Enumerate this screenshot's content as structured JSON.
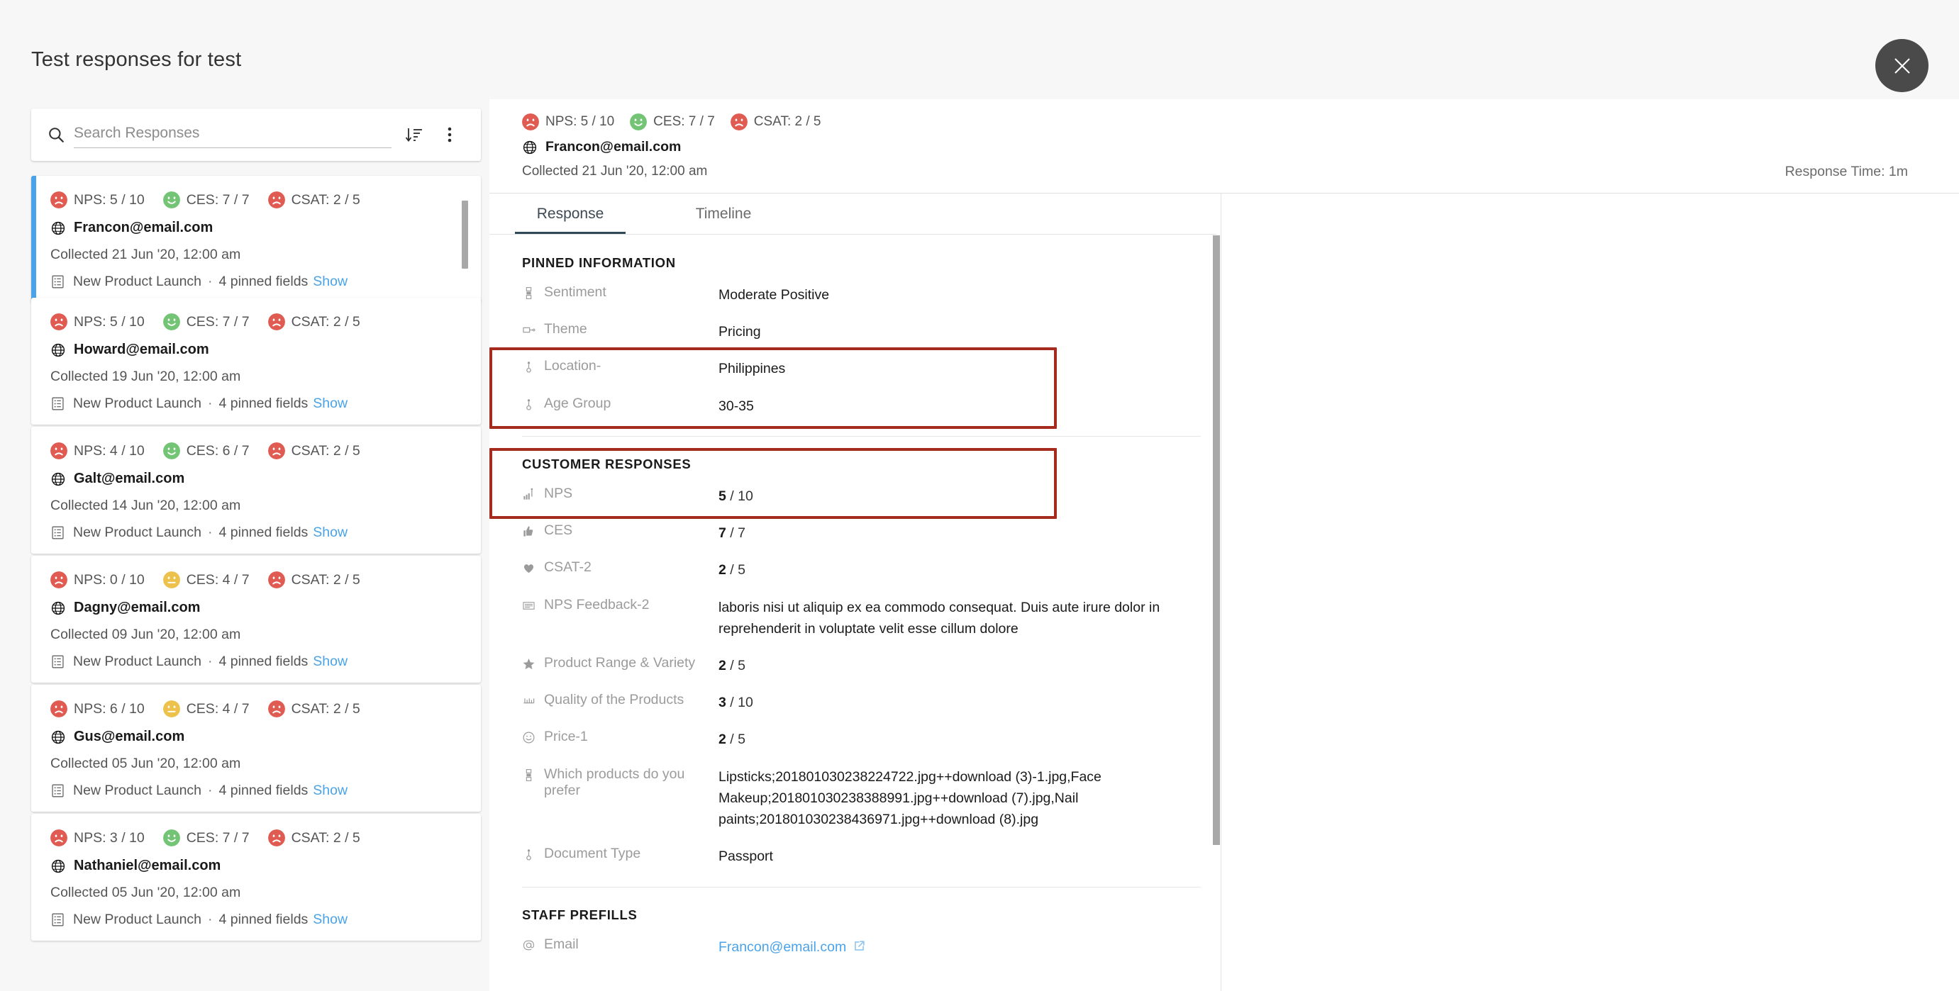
{
  "header": {
    "title": "Test responses for test",
    "close_icon": "close-icon"
  },
  "search": {
    "placeholder": "Search Responses",
    "value": "",
    "search_icon": "search-icon",
    "sort_icon": "sort-descending-icon",
    "more_icon": "more-vertical-icon"
  },
  "responses": [
    {
      "nps_label": "NPS: 5 / 10",
      "nps_face": "sad",
      "nps_color": "#e05b52",
      "ces_label": "CES: 7 / 7",
      "ces_face": "happy",
      "ces_color": "#74c476",
      "csat_label": "CSAT: 2 / 5",
      "csat_face": "sad",
      "csat_color": "#e05b52",
      "email": "Francon@email.com",
      "email_icon": "globe-icon",
      "collected": "Collected 21 Jun '20, 12:00 am",
      "survey_icon": "survey-list-icon",
      "survey": "New Product Launch",
      "separator": "·",
      "pinned_fields": "4 pinned fields",
      "show_label": "Show",
      "selected": true
    },
    {
      "nps_label": "NPS: 5 / 10",
      "nps_face": "sad",
      "nps_color": "#e05b52",
      "ces_label": "CES: 7 / 7",
      "ces_face": "happy",
      "ces_color": "#74c476",
      "csat_label": "CSAT: 2 / 5",
      "csat_face": "sad",
      "csat_color": "#e05b52",
      "email": "Howard@email.com",
      "email_icon": "globe-icon",
      "collected": "Collected 19 Jun '20, 12:00 am",
      "survey_icon": "survey-list-icon",
      "survey": "New Product Launch",
      "separator": "·",
      "pinned_fields": "4 pinned fields",
      "show_label": "Show",
      "selected": false
    },
    {
      "nps_label": "NPS: 4 / 10",
      "nps_face": "sad",
      "nps_color": "#e05b52",
      "ces_label": "CES: 6 / 7",
      "ces_face": "happy",
      "ces_color": "#74c476",
      "csat_label": "CSAT: 2 / 5",
      "csat_face": "sad",
      "csat_color": "#e05b52",
      "email": "Galt@email.com",
      "email_icon": "globe-icon",
      "collected": "Collected 14 Jun '20, 12:00 am",
      "survey_icon": "survey-list-icon",
      "survey": "New Product Launch",
      "separator": "·",
      "pinned_fields": "4 pinned fields",
      "show_label": "Show",
      "selected": false
    },
    {
      "nps_label": "NPS: 0 / 10",
      "nps_face": "sad",
      "nps_color": "#e05b52",
      "ces_label": "CES: 4 / 7",
      "ces_face": "neutral",
      "ces_color": "#edc24c",
      "csat_label": "CSAT: 2 / 5",
      "csat_face": "sad",
      "csat_color": "#e05b52",
      "email": "Dagny@email.com",
      "email_icon": "globe-icon",
      "collected": "Collected 09 Jun '20, 12:00 am",
      "survey_icon": "survey-list-icon",
      "survey": "New Product Launch",
      "separator": "·",
      "pinned_fields": "4 pinned fields",
      "show_label": "Show",
      "selected": false
    },
    {
      "nps_label": "NPS: 6 / 10",
      "nps_face": "sad",
      "nps_color": "#e05b52",
      "ces_label": "CES: 4 / 7",
      "ces_face": "neutral",
      "ces_color": "#edc24c",
      "csat_label": "CSAT: 2 / 5",
      "csat_face": "sad",
      "csat_color": "#e05b52",
      "email": "Gus@email.com",
      "email_icon": "globe-icon",
      "collected": "Collected 05 Jun '20, 12:00 am",
      "survey_icon": "survey-list-icon",
      "survey": "New Product Launch",
      "separator": "·",
      "pinned_fields": "4 pinned fields",
      "show_label": "Show",
      "selected": false
    },
    {
      "nps_label": "NPS: 3 / 10",
      "nps_face": "sad",
      "nps_color": "#e05b52",
      "ces_label": "CES: 7 / 7",
      "ces_face": "happy",
      "ces_color": "#74c476",
      "csat_label": "CSAT: 2 / 5",
      "csat_face": "sad",
      "csat_color": "#e05b52",
      "email": "Nathaniel@email.com",
      "email_icon": "globe-icon",
      "collected": "Collected 05 Jun '20, 12:00 am",
      "survey_icon": "survey-list-icon",
      "survey": "New Product Launch",
      "separator": "·",
      "pinned_fields": "4 pinned fields",
      "show_label": "Show",
      "selected": false
    }
  ],
  "detail": {
    "nps_label": "NPS: 5 / 10",
    "ces_label": "CES: 7 / 7",
    "csat_label": "CSAT: 2 / 5",
    "email": "Francon@email.com",
    "collected": "Collected 21 Jun '20, 12:00 am",
    "response_time": "Response Time: 1m",
    "tabs": [
      {
        "label": "Response",
        "active": true
      },
      {
        "label": "Timeline",
        "active": false
      }
    ],
    "sections": [
      {
        "title": "PINNED INFORMATION",
        "fields": [
          {
            "icon": "text-field-icon",
            "label": "Sentiment",
            "value": "Moderate Positive"
          },
          {
            "icon": "tag-icon",
            "label": "Theme",
            "value": "Pricing"
          },
          {
            "icon": "dropdown-icon",
            "label": "Location-",
            "value": "Philippines"
          },
          {
            "icon": "dropdown-icon",
            "label": "Age Group",
            "value": "30-35"
          }
        ]
      },
      {
        "title": "CUSTOMER RESPONSES",
        "fields": [
          {
            "icon": "bar-chart-icon",
            "label": "NPS",
            "score": "5",
            "denominator": " / 10"
          },
          {
            "icon": "thumbs-up-icon",
            "label": "CES",
            "score": "7",
            "denominator": " / 7"
          },
          {
            "icon": "heart-icon",
            "label": "CSAT-2",
            "score": "2",
            "denominator": " / 5"
          },
          {
            "icon": "paragraph-icon",
            "label": "NPS Feedback-2",
            "value": "laboris nisi ut aliquip ex ea commodo consequat. Duis aute irure dolor in reprehenderit in voluptate velit esse cillum dolore"
          },
          {
            "icon": "star-icon",
            "label": "Product Range & Variety",
            "score": "2",
            "denominator": " / 5"
          },
          {
            "icon": "scale-icon",
            "label": "Quality of the Products",
            "score": "3",
            "denominator": " / 10"
          },
          {
            "icon": "smiley-icon",
            "label": "Price-1",
            "score": "2",
            "denominator": " / 5"
          },
          {
            "icon": "text-field-icon",
            "label": "Which products do you prefer",
            "value": "Lipsticks;201801030238224722.jpg++download (3)-1.jpg,Face Makeup;201801030238388991.jpg++download (7).jpg,Nail paints;201801030238436971.jpg++download (8).jpg"
          },
          {
            "icon": "dropdown-icon",
            "label": "Document Type",
            "value": "Passport"
          }
        ]
      },
      {
        "title": "STAFF PREFILLS",
        "fields": [
          {
            "icon": "at-icon",
            "label": "Email",
            "link": "Francon@email.com",
            "link_icon": "external-link-icon"
          }
        ]
      }
    ]
  },
  "colors": {
    "accent_blue": "#4aa3e8",
    "annotation_red": "#a62b1f",
    "tab_active": "#2f4858",
    "face_sad": "#e05b52",
    "face_happy": "#74c476",
    "face_neutral": "#edc24c"
  }
}
